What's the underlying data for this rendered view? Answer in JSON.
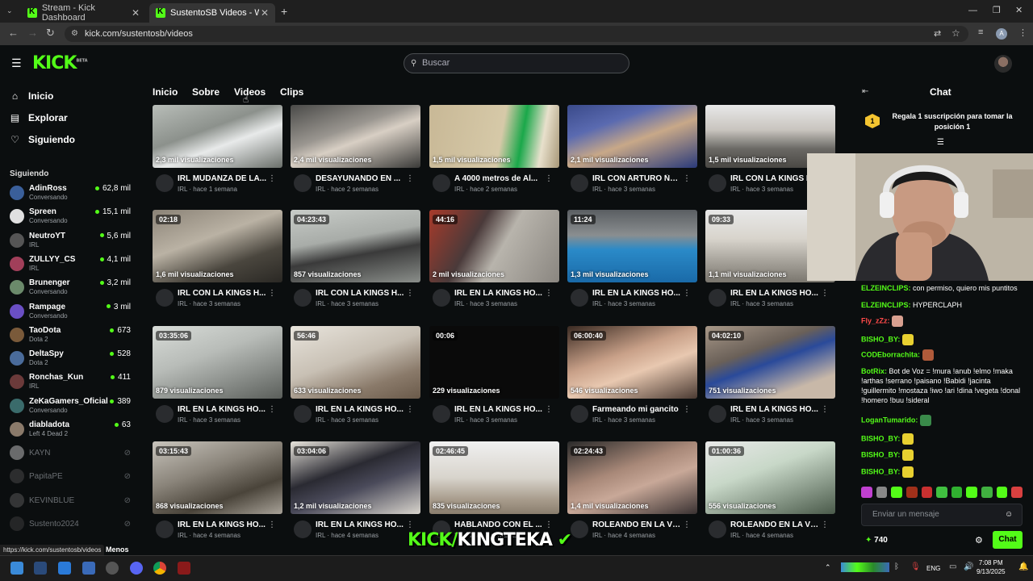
{
  "browser": {
    "tabs": [
      {
        "label": "Stream - Kick Dashboard",
        "active": false
      },
      {
        "label": "SustentoSB Videos - Watch On",
        "active": true
      }
    ],
    "url": "kick.com/sustentosb/videos",
    "status_url": "https://kick.com/sustentosb/videos",
    "status_extra": "Menos"
  },
  "header": {
    "logo": "KICK",
    "logo_tag": "BETA",
    "search_placeholder": "Buscar"
  },
  "sidebar": {
    "nav": [
      {
        "label": "Inicio",
        "icon": "home-icon"
      },
      {
        "label": "Explorar",
        "icon": "compass-icon"
      },
      {
        "label": "Siguiendo",
        "icon": "heart-icon"
      }
    ],
    "following_title": "Siguiendo",
    "following": [
      {
        "name": "AdinRoss",
        "category": "Conversando",
        "viewers": "62,8 mil",
        "color": "#3a5f9a"
      },
      {
        "name": "Spreen",
        "category": "Conversando",
        "viewers": "15,1 mil",
        "color": "#e0e0e0"
      },
      {
        "name": "NeutroYT",
        "category": "IRL",
        "viewers": "5,6 mil",
        "color": "#555"
      },
      {
        "name": "ZULLYY_CS",
        "category": "IRL",
        "viewers": "4,1 mil",
        "color": "#a13f5a"
      },
      {
        "name": "Brunenger",
        "category": "Conversando",
        "viewers": "3,2 mil",
        "color": "#6b8a6b"
      },
      {
        "name": "Rampage",
        "category": "Conversando",
        "viewers": "3 mil",
        "color": "#6a4fc4"
      },
      {
        "name": "TaoDota",
        "category": "Dota 2",
        "viewers": "673",
        "color": "#7a5a3a"
      },
      {
        "name": "DeltaSpy",
        "category": "Dota 2",
        "viewers": "528",
        "color": "#4a6b9a"
      },
      {
        "name": "Ronchas_Kun",
        "category": "IRL",
        "viewers": "411",
        "color": "#6b3a3a"
      },
      {
        "name": "ZeKaGamers_Oficial",
        "category": "Conversando",
        "viewers": "389",
        "color": "#3a6b6b"
      },
      {
        "name": "diabladota",
        "category": "Left 4 Dead 2",
        "viewers": "63",
        "color": "#8a7a6a"
      }
    ],
    "offline": [
      {
        "name": "KAYN",
        "color": "#ddd"
      },
      {
        "name": "PapitaPE",
        "color": "#555"
      },
      {
        "name": "KEVINBLUE",
        "color": "#666"
      },
      {
        "name": "Sustento2024",
        "color": "#444"
      }
    ]
  },
  "channel_tabs": [
    "Inicio",
    "Sobre",
    "Videos",
    "Clips"
  ],
  "videos": [
    {
      "dur": "",
      "views": "2,3 mil visualizaciones",
      "title": "IRL MUDANZA DE LA...",
      "meta": "IRL · hace 1 semana",
      "bg": "linear-gradient(160deg,#b8bdb8 0%,#8c918c 40%,#e8eaea 60%,#6a6f6a 100%)"
    },
    {
      "dur": "",
      "views": "2,4 mil visualizaciones",
      "title": "DESAYUNANDO EN ...",
      "meta": "IRL · hace 2 semanas",
      "bg": "linear-gradient(160deg,#4a4a48 0%,#9a9690 40%,#d8cfc4 55%,#3a3a38 100%)"
    },
    {
      "dur": "",
      "views": "1,5 mil visualizaciones",
      "title": "A 4000 metros de Al...",
      "meta": "IRL · hace 2 semanas",
      "bg": "linear-gradient(100deg,#c8b896 0%,#d6c9a8 55%,#1aa84a 70%,#e8e0cc 85%,#a89878 100%)"
    },
    {
      "dur": "",
      "views": "2,1 mil visualizaciones",
      "title": "IRL CON ARTURO ÑA...",
      "meta": "IRL · hace 3 semanas",
      "bg": "linear-gradient(160deg,#3a4a8a 0%,#5a6ab0 30%,#c8a888 55%,#2a3a7a 100%)"
    },
    {
      "dur": "",
      "views": "1,5 mil visualizaciones",
      "title": "IRL CON LA KINGS H...",
      "meta": "IRL · hace 3 semanas",
      "bg": "linear-gradient(180deg,#e8e8e8 0%,#c8c4be 40%,#6a6864 70%,#4a4844 100%)"
    },
    {
      "dur": "02:18",
      "views": "1,6 mil visualizaciones",
      "title": "IRL CON LA KINGS H...",
      "meta": "IRL · hace 3 semanas",
      "bg": "linear-gradient(160deg,#8a8276 0%,#bab2a4 40%,#4a463e 70%,#2a2824 100%)"
    },
    {
      "dur": "04:23:43",
      "views": "857 visualizaciones",
      "title": "IRL CON LA KINGS H...",
      "meta": "IRL · hace 3 semanas",
      "bg": "linear-gradient(170deg,#c8ccc8 0%,#a8aca8 40%,#3a3a3a 60%,#8a8e8a 100%)"
    },
    {
      "dur": "44:16",
      "views": "2 mil visualizaciones",
      "title": "IRL EN LA KINGS HO...",
      "meta": "IRL · hace 3 semanas",
      "bg": "linear-gradient(120deg,#a83a2a 0%,#4a3a3a 35%,#b8b4ac 55%,#8a8680 100%)"
    },
    {
      "dur": "11:24",
      "views": "1,3 mil visualizaciones",
      "title": "IRL EN LA KINGS HO...",
      "meta": "IRL · hace 3 semanas",
      "bg": "linear-gradient(180deg,#5a5e62 0%,#8a8e90 35%,#2a8ac8 55%,#1a6aa8 100%)"
    },
    {
      "dur": "09:33",
      "views": "1,1 mil visualizaciones",
      "title": "IRL EN LA KINGS HO...",
      "meta": "IRL · hace 3 semanas",
      "bg": "linear-gradient(180deg,#e8e8e8 0%,#d8d4cc 40%,#a8a49c 70%,#7a766e 100%)"
    },
    {
      "dur": "03:35:06",
      "views": "879 visualizaciones",
      "title": "IRL EN LA KINGS HO...",
      "meta": "IRL · hace 3 semanas",
      "bg": "linear-gradient(160deg,#d8dcd8 0%,#b8bcb8 40%,#8a8e8a 70%,#5a5e5a 100%)"
    },
    {
      "dur": "56:46",
      "views": "633 visualizaciones",
      "title": "IRL EN LA KINGS HO...",
      "meta": "IRL · hace 3 semanas",
      "bg": "linear-gradient(160deg,#e8e4dc 0%,#c8c0b4 45%,#8a7a6a 75%,#6a5a4a 100%)"
    },
    {
      "dur": "00:06",
      "views": "229 visualizaciones",
      "title": "IRL EN LA KINGS HO...",
      "meta": "IRL · hace 3 semanas",
      "bg": "#0a0a0a"
    },
    {
      "dur": "06:00:40",
      "views": "546 visualizaciones",
      "title": "Farmeando mi gancito",
      "meta": "IRL · hace 3 semanas",
      "bg": "linear-gradient(160deg,#3a2a22 0%,#c8a088 40%,#e8c8b0 60%,#4a3a32 100%)"
    },
    {
      "dur": "04:02:10",
      "views": "751 visualizaciones",
      "title": "IRL EN LA KINGS HO...",
      "meta": "IRL · hace 3 semanas",
      "bg": "linear-gradient(160deg,#a89888 0%,#6a6058 35%,#2a4a9a 50%,#c8b8a8 80%)"
    },
    {
      "dur": "03:15:43",
      "views": "868 visualizaciones",
      "title": "IRL EN LA KINGS HO...",
      "meta": "IRL · hace 4 semanas",
      "bg": "linear-gradient(160deg,#c8c4bc 0%,#8a847a 40%,#4a443a 70%,#a8a298 100%)"
    },
    {
      "dur": "03:04:06",
      "views": "1,2 mil visualizaciones",
      "title": "IRL EN LA KINGS HO...",
      "meta": "IRL · hace 4 semanas",
      "bg": "linear-gradient(160deg,#e8e4dc 0%,#2a2a32 40%,#4a4a5a 60%,#d8d4cc 100%)"
    },
    {
      "dur": "02:46:45",
      "views": "835 visualizaciones",
      "title": "HABLANDO CON EL ...",
      "meta": "IRL · hace 4 semanas",
      "bg": "linear-gradient(180deg,#f0f0f0 0%,#d8d4cc 50%,#a89c8c 80%,#8a7e6e 100%)"
    },
    {
      "dur": "02:24:43",
      "views": "1,4 mil visualizaciones",
      "title": "ROLEANDO EN LA VI...",
      "meta": "IRL · hace 4 semanas",
      "bg": "linear-gradient(160deg,#2a2a2a 0%,#a88878 40%,#c8a898 60%,#3a3232 100%)"
    },
    {
      "dur": "01:00:36",
      "views": "556 visualizaciones",
      "title": "ROLEANDO EN LA VI...",
      "meta": "IRL · hace 4 semanas",
      "bg": "linear-gradient(160deg,#e8e8e8 0%,#c8d8c8 40%,#8a9a8a 70%,#4a5a4a 100%)"
    }
  ],
  "chat": {
    "title": "Chat",
    "sub_banner_rank": "1",
    "sub_banner": "Regala 1 suscripción para tomar la posición 1",
    "messages": [
      {
        "user": "ELZEINCLIPS:",
        "text": "con permiso, quiero mis puntitos",
        "color": "#53fc18",
        "emote": ""
      },
      {
        "user": "ELZEINCLIPS:",
        "text": "HYPERCLAPH",
        "color": "#53fc18",
        "emote": ""
      },
      {
        "user": "Fly_zZz:",
        "text": "",
        "color": "#ff4a4a",
        "emote": "#d8a090"
      },
      {
        "user": "BISHO_BY:",
        "text": "",
        "color": "#53fc18",
        "emote": "#e8d030"
      },
      {
        "user": "CODEborrachita:",
        "text": "",
        "color": "#53fc18",
        "emote": "#b05a3a"
      },
      {
        "user": "BotRix:",
        "text": "Bot de Voz = !mura !anub !elmo !maka !arthas !serrano !paisano !Babidi !jacinta !guillermito !mostaza !iwo !ari !dina !vegeta !donal !homero !buu !sideral",
        "color": "#53fc18",
        "emote": ""
      },
      {
        "user": "LoganTumarido:",
        "text": "",
        "color": "#53fc18",
        "emote": "#3a8a4a"
      },
      {
        "user": "BISHO_BY:",
        "text": "",
        "color": "#53fc18",
        "emote": "#e8d030"
      },
      {
        "user": "BISHO_BY:",
        "text": "",
        "color": "#53fc18",
        "emote": "#e8d030"
      },
      {
        "user": "BISHO_BY:",
        "text": "",
        "color": "#53fc18",
        "emote": "#e8d030"
      }
    ],
    "input_placeholder": "Enviar un mensaje",
    "points": "740",
    "send_label": "Chat"
  },
  "overlay_banner": {
    "left": "KICK/",
    "right": "KINGTEKA"
  },
  "taskbar": {
    "lang": "ENG",
    "time": "7:08 PM",
    "date": "9/13/2025"
  },
  "colors": {
    "brand": "#53fc18",
    "bg": "#0b0e0f"
  }
}
